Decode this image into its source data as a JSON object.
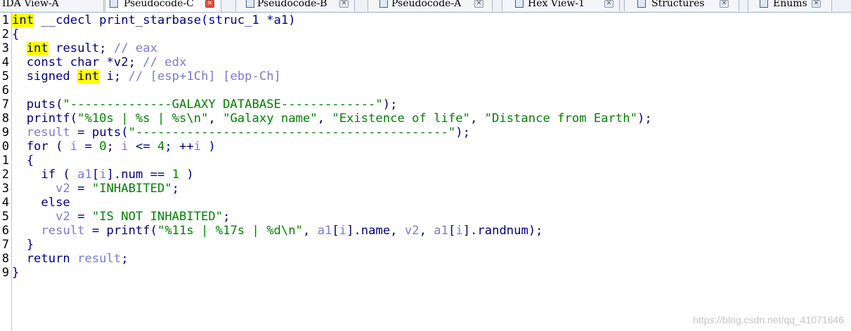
{
  "tabs": [
    {
      "label": "IDA View-A",
      "icon": "ida-view-icon",
      "active": false
    },
    {
      "label": "Pseudocode-C",
      "icon": "pseudocode-icon",
      "active": true
    },
    {
      "label": "Pseudocode-B",
      "icon": "pseudocode-icon",
      "active": false
    },
    {
      "label": "Pseudocode-A",
      "icon": "pseudocode-icon",
      "active": false
    },
    {
      "label": "Hex View-1",
      "icon": "hex-view-icon",
      "active": false
    },
    {
      "label": "Structures",
      "icon": "structures-icon",
      "active": false
    },
    {
      "label": "Enums",
      "icon": "enums-icon",
      "active": false
    }
  ],
  "gutter": {
    "line_numbers": [
      "1",
      "2",
      "3",
      "4",
      "5",
      "6",
      "7",
      "8",
      "9",
      "0",
      "1",
      "2",
      "3",
      "4",
      "5",
      "6",
      "7",
      "8",
      "9"
    ]
  },
  "code": {
    "lines": [
      [
        {
          "t": "int",
          "c": "hl"
        },
        {
          "t": " __cdecl print_starbase(struc_1 *a1)",
          "c": "plain"
        }
      ],
      [
        {
          "t": "{",
          "c": "plain"
        }
      ],
      [
        {
          "t": "  ",
          "c": "plain"
        },
        {
          "t": "int",
          "c": "hl"
        },
        {
          "t": " result; ",
          "c": "plain"
        },
        {
          "t": "// eax",
          "c": "comment"
        }
      ],
      [
        {
          "t": "  const char *v2; ",
          "c": "plain"
        },
        {
          "t": "// edx",
          "c": "comment"
        }
      ],
      [
        {
          "t": "  signed ",
          "c": "plain"
        },
        {
          "t": "int",
          "c": "hl"
        },
        {
          "t": " i; ",
          "c": "plain"
        },
        {
          "t": "// [esp+1Ch] [ebp-Ch]",
          "c": "comment"
        }
      ],
      [],
      [
        {
          "t": "  puts(",
          "c": "plain"
        },
        {
          "t": "\"--------------GALAXY DATABASE-------------\"",
          "c": "str"
        },
        {
          "t": ");",
          "c": "plain"
        }
      ],
      [
        {
          "t": "  printf(",
          "c": "plain"
        },
        {
          "t": "\"%10s | %s | %s\\n\"",
          "c": "str"
        },
        {
          "t": ", ",
          "c": "plain"
        },
        {
          "t": "\"Galaxy name\"",
          "c": "str"
        },
        {
          "t": ", ",
          "c": "plain"
        },
        {
          "t": "\"Existence of life\"",
          "c": "str"
        },
        {
          "t": ", ",
          "c": "plain"
        },
        {
          "t": "\"Distance from Earth\"",
          "c": "str"
        },
        {
          "t": ");",
          "c": "plain"
        }
      ],
      [
        {
          "t": "  ",
          "c": "plain"
        },
        {
          "t": "result",
          "c": "var"
        },
        {
          "t": " = puts(",
          "c": "plain"
        },
        {
          "t": "\"-------------------------------------------\"",
          "c": "str"
        },
        {
          "t": ");",
          "c": "plain"
        }
      ],
      [
        {
          "t": "  for ( ",
          "c": "plain"
        },
        {
          "t": "i",
          "c": "var"
        },
        {
          "t": " = ",
          "c": "plain"
        },
        {
          "t": "0",
          "c": "num"
        },
        {
          "t": "; ",
          "c": "plain"
        },
        {
          "t": "i",
          "c": "var"
        },
        {
          "t": " <= ",
          "c": "plain"
        },
        {
          "t": "4",
          "c": "num"
        },
        {
          "t": "; ++",
          "c": "plain"
        },
        {
          "t": "i",
          "c": "var"
        },
        {
          "t": " )",
          "c": "plain"
        }
      ],
      [
        {
          "t": "  {",
          "c": "plain"
        }
      ],
      [
        {
          "t": "    if ( ",
          "c": "plain"
        },
        {
          "t": "a1",
          "c": "var"
        },
        {
          "t": "[",
          "c": "plain"
        },
        {
          "t": "i",
          "c": "var"
        },
        {
          "t": "].num == ",
          "c": "plain"
        },
        {
          "t": "1",
          "c": "num"
        },
        {
          "t": " )",
          "c": "plain"
        }
      ],
      [
        {
          "t": "      ",
          "c": "plain"
        },
        {
          "t": "v2",
          "c": "var"
        },
        {
          "t": " = ",
          "c": "plain"
        },
        {
          "t": "\"INHABITED\"",
          "c": "str"
        },
        {
          "t": ";",
          "c": "plain"
        }
      ],
      [
        {
          "t": "    else",
          "c": "plain"
        }
      ],
      [
        {
          "t": "      ",
          "c": "plain"
        },
        {
          "t": "v2",
          "c": "var"
        },
        {
          "t": " = ",
          "c": "plain"
        },
        {
          "t": "\"IS NOT INHABITED\"",
          "c": "str"
        },
        {
          "t": ";",
          "c": "plain"
        }
      ],
      [
        {
          "t": "    ",
          "c": "plain"
        },
        {
          "t": "result",
          "c": "var"
        },
        {
          "t": " = printf(",
          "c": "plain"
        },
        {
          "t": "\"%11s | %17s | %d\\n\"",
          "c": "str"
        },
        {
          "t": ", ",
          "c": "plain"
        },
        {
          "t": "a1",
          "c": "var"
        },
        {
          "t": "[",
          "c": "plain"
        },
        {
          "t": "i",
          "c": "var"
        },
        {
          "t": "].name, ",
          "c": "plain"
        },
        {
          "t": "v2",
          "c": "var"
        },
        {
          "t": ", ",
          "c": "plain"
        },
        {
          "t": "a1",
          "c": "var"
        },
        {
          "t": "[",
          "c": "plain"
        },
        {
          "t": "i",
          "c": "var"
        },
        {
          "t": "].randnum);",
          "c": "plain"
        }
      ],
      [
        {
          "t": "  }",
          "c": "plain"
        }
      ],
      [
        {
          "t": "  return ",
          "c": "plain"
        },
        {
          "t": "result",
          "c": "var"
        },
        {
          "t": ";",
          "c": "plain"
        }
      ],
      [
        {
          "t": "}",
          "c": "plain"
        }
      ]
    ]
  },
  "watermark": "https://blog.csdn.net/qq_41071646"
}
